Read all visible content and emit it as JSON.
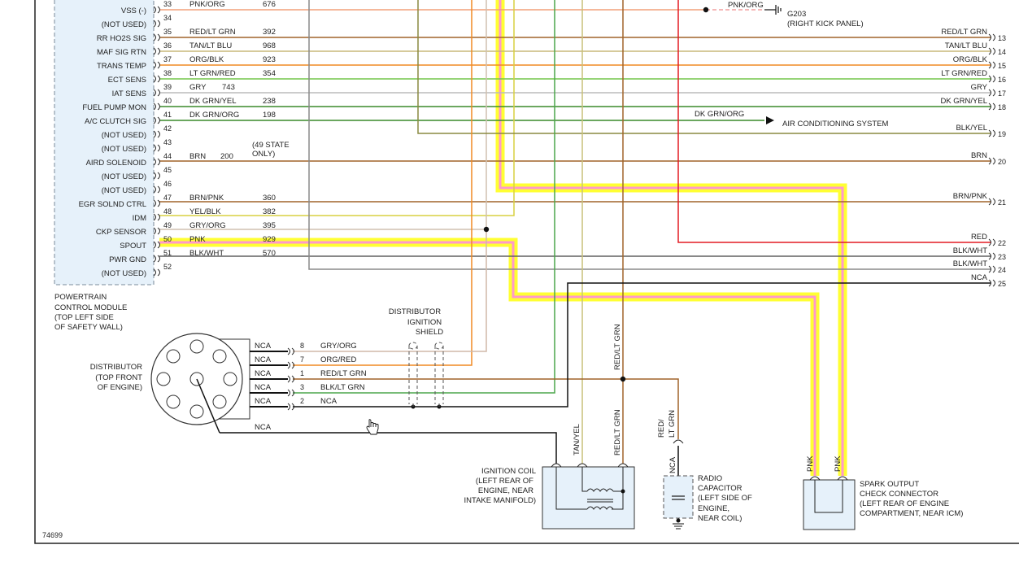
{
  "pcm": {
    "title_lines": [
      "POWERTRAIN",
      "CONTROL MODULE",
      "(TOP LEFT SIDE",
      "OF SAFETY WALL)"
    ],
    "pins": [
      {
        "pin": "33",
        "label": "VSS (-)",
        "color": "PNK/ORG",
        "circuit": "676"
      },
      {
        "pin": "34",
        "label": "(NOT USED)",
        "color": "",
        "circuit": ""
      },
      {
        "pin": "35",
        "label": "RR HO2S SIG",
        "color": "RED/LT GRN",
        "circuit": "392"
      },
      {
        "pin": "36",
        "label": "MAF SIG RTN",
        "color": "TAN/LT BLU",
        "circuit": "968"
      },
      {
        "pin": "37",
        "label": "TRANS TEMP",
        "color": "ORG/BLK",
        "circuit": "923"
      },
      {
        "pin": "38",
        "label": "ECT SENS",
        "color": "LT GRN/RED",
        "circuit": "354"
      },
      {
        "pin": "39",
        "label": "IAT SENS",
        "color": "GRY",
        "circuit": "743"
      },
      {
        "pin": "40",
        "label": "FUEL PUMP MON",
        "color": "DK GRN/YEL",
        "circuit": "238"
      },
      {
        "pin": "41",
        "label": "A/C CLUTCH SIG",
        "color": "DK GRN/ORG",
        "circuit": "198"
      },
      {
        "pin": "42",
        "label": "(NOT USED)",
        "color": "",
        "circuit": ""
      },
      {
        "pin": "43",
        "label": "(NOT USED)",
        "color": "",
        "circuit": ""
      },
      {
        "pin": "44",
        "label": "AIRD SOLENOID",
        "color": "BRN",
        "circuit": "200"
      },
      {
        "pin": "45",
        "label": "(NOT USED)",
        "color": "",
        "circuit": ""
      },
      {
        "pin": "46",
        "label": "(NOT USED)",
        "color": "",
        "circuit": ""
      },
      {
        "pin": "47",
        "label": "EGR SOLND CTRL",
        "color": "BRN/PNK",
        "circuit": "360"
      },
      {
        "pin": "48",
        "label": "IDM",
        "color": "YEL/BLK",
        "circuit": "382"
      },
      {
        "pin": "49",
        "label": "CKP SENSOR",
        "color": "GRY/ORG",
        "circuit": "395"
      },
      {
        "pin": "50",
        "label": "SPOUT",
        "color": "PNK",
        "circuit": "929"
      },
      {
        "pin": "51",
        "label": "PWR GND",
        "color": "BLK/WHT",
        "circuit": "570"
      },
      {
        "pin": "52",
        "label": "(NOT USED)",
        "color": "",
        "circuit": ""
      }
    ],
    "note_49_state": [
      "(49 STATE",
      "ONLY)"
    ]
  },
  "right_terminals": [
    {
      "num": "13",
      "label": "RED/LT GRN"
    },
    {
      "num": "14",
      "label": "TAN/LT BLU"
    },
    {
      "num": "15",
      "label": "ORG/BLK"
    },
    {
      "num": "16",
      "label": "LT GRN/RED"
    },
    {
      "num": "17",
      "label": "GRY"
    },
    {
      "num": "18",
      "label": "DK GRN/YEL"
    },
    {
      "num": "19",
      "label": "BLK/YEL"
    },
    {
      "num": "20",
      "label": "BRN"
    },
    {
      "num": "21",
      "label": "BRN/PNK"
    },
    {
      "num": "22",
      "label": "RED"
    },
    {
      "num": "23",
      "label": "BLK/WHT"
    },
    {
      "num": "24",
      "label": "BLK/WHT"
    },
    {
      "num": "25",
      "label": "NCA"
    }
  ],
  "ground": {
    "wire": "PNK/ORG",
    "name": "G203",
    "location": "(RIGHT KICK PANEL)"
  },
  "ac": {
    "wire": "DK GRN/ORG",
    "label": "AIR CONDITIONING SYSTEM"
  },
  "distributor": {
    "title_lines": [
      "DISTRIBUTOR",
      "(TOP FRONT",
      "OF ENGINE)"
    ],
    "pins": [
      {
        "nca": "NCA",
        "num": "8",
        "color": "GRY/ORG"
      },
      {
        "nca": "NCA",
        "num": "7",
        "color": "ORG/RED"
      },
      {
        "nca": "NCA",
        "num": "1",
        "color": "RED/LT GRN"
      },
      {
        "nca": "NCA",
        "num": "3",
        "color": "BLK/LT GRN"
      },
      {
        "nca": "NCA",
        "num": "2",
        "color": "NCA"
      }
    ],
    "extra_nca": "NCA"
  },
  "shield": {
    "lines": [
      "DISTRIBUTOR",
      "IGNITION",
      "SHIELD"
    ]
  },
  "coil": {
    "lines": [
      "IGNITION COIL",
      "(LEFT REAR OF",
      "ENGINE, NEAR",
      "INTAKE MANIFOLD)"
    ],
    "wire1": "TAN/YEL",
    "wire2": "RED/LT GRN"
  },
  "vertical_labels": {
    "red_lt_grn": "RED/LT GRN"
  },
  "capacitor": {
    "lines": [
      "RADIO",
      "CAPACITOR",
      "(LEFT SIDE OF",
      "ENGINE,",
      "NEAR COIL)"
    ],
    "wire_a": "RED/",
    "wire_b": "LT GRN",
    "nca": "NCA"
  },
  "spark": {
    "lines": [
      "SPARK OUTPUT",
      "CHECK CONNECTOR",
      "(LEFT REAR OF ENGINE",
      "COMPARTMENT, NEAR ICM)"
    ],
    "wire1": "PNK",
    "wire2": "PNK"
  },
  "figure_id": "74699",
  "colors": {
    "highlight": "#ffff33",
    "pink": "#ff99cc",
    "red": "#e31b23",
    "orange": "#f08a24",
    "green": "#4ca64c",
    "brown": "#a0642a",
    "gray": "#909090",
    "tan": "#c8b87a",
    "yellow": "#d8d040",
    "pcm_fill": "#e6f1fa",
    "frame": "#222222"
  }
}
